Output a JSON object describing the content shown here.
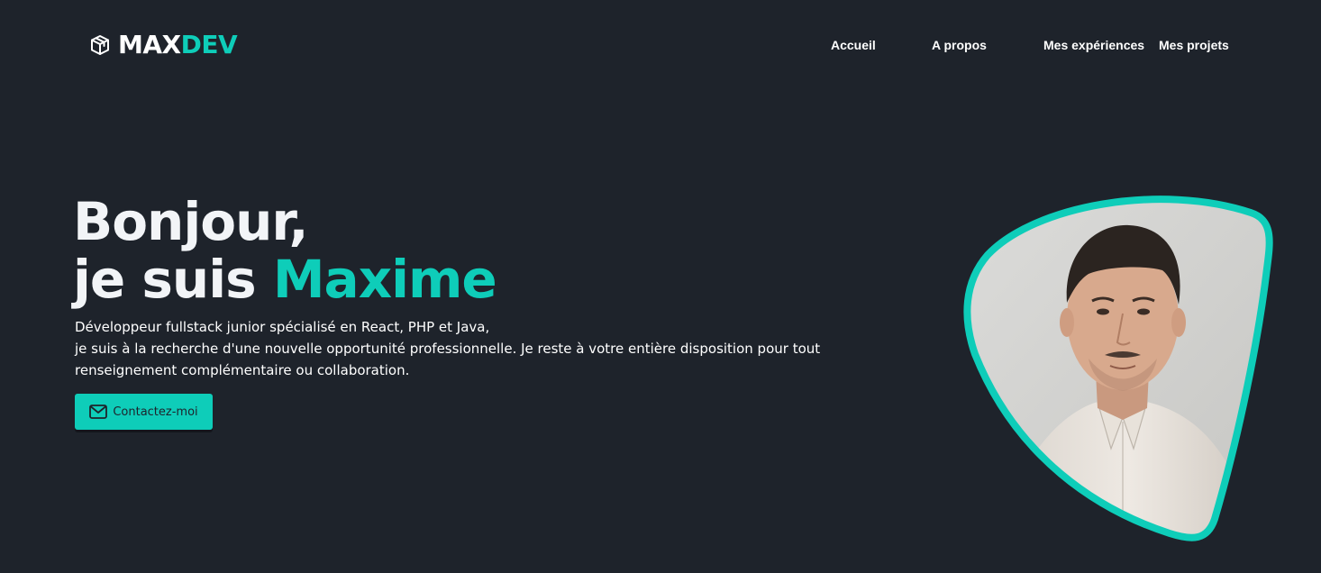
{
  "logo": {
    "name_part1": "MAX",
    "name_part2": "DEV",
    "icon": "cube-icon"
  },
  "nav": {
    "items": [
      {
        "label": "Accueil"
      },
      {
        "label": "A propos"
      },
      {
        "label": "Mes expériences"
      },
      {
        "label": "Mes projets"
      }
    ]
  },
  "hero": {
    "greeting": "Bonjour,",
    "intro_prefix": "je suis",
    "name": "Maxime",
    "line1": "Développeur fullstack junior spécialisé en React, PHP et Java,",
    "line2": "je suis à la recherche d'une nouvelle opportunité professionnelle. Je reste à votre entière disposition pour tout renseignement complémentaire ou collaboration.",
    "contact_label": "Contactez-moi",
    "contact_icon": "mail-icon"
  },
  "portrait": {
    "type": "profile-photo"
  },
  "colors": {
    "background": "#1e232b",
    "accent": "#0ecdb9",
    "text": "#ffffff"
  }
}
